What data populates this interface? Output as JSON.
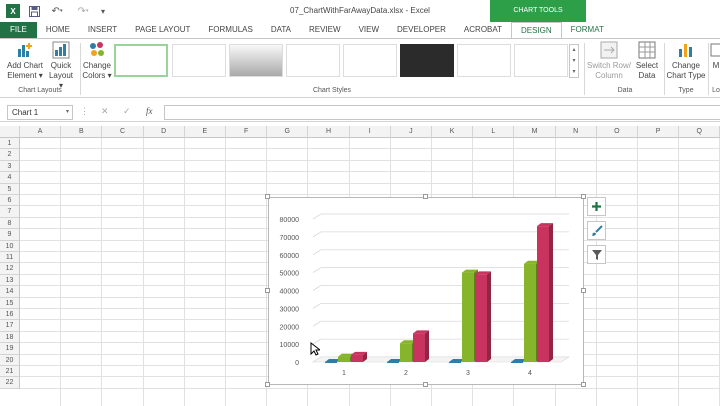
{
  "window": {
    "title": "07_ChartWithFarAwayData.xlsx - Excel",
    "context_tab": "CHART TOOLS"
  },
  "tabs": [
    "FILE",
    "HOME",
    "INSERT",
    "PAGE LAYOUT",
    "FORMULAS",
    "DATA",
    "REVIEW",
    "VIEW",
    "DEVELOPER",
    "ACROBAT",
    "DESIGN",
    "FORMAT"
  ],
  "ribbon": {
    "add_chart_element": [
      "Add Chart",
      "Element ▾"
    ],
    "quick_layout": [
      "Quick",
      "Layout ▾"
    ],
    "change_colors": [
      "Change",
      "Colors ▾"
    ],
    "switch_row_column": [
      "Switch Row/",
      "Column"
    ],
    "select_data": [
      "Select",
      "Data"
    ],
    "change_chart_type": [
      "Change",
      "Chart Type"
    ],
    "move_chart": [
      "M",
      "Lo"
    ],
    "groups": {
      "chart_layouts": "Chart Layouts",
      "chart_styles": "Chart Styles",
      "data": "Data",
      "type": "Type"
    }
  },
  "formula_bar": {
    "name_box": "Chart 1",
    "cancel": "✕",
    "enter": "✓",
    "fx": "fx",
    "value": ""
  },
  "columns": [
    "A",
    "B",
    "C",
    "D",
    "E",
    "F",
    "G",
    "H",
    "I",
    "J",
    "K",
    "L",
    "M",
    "N",
    "O",
    "P",
    "Q"
  ],
  "rows": [
    "1",
    "2",
    "3",
    "4",
    "5",
    "6",
    "7",
    "8",
    "9",
    "10",
    "11",
    "12",
    "13",
    "14",
    "15",
    "16",
    "17",
    "18",
    "19",
    "20",
    "21",
    "22"
  ],
  "colors": {
    "green": "#86b42a",
    "crimson": "#c8335f",
    "teal": "#2e7fa6",
    "excel_green": "#217346"
  },
  "chart_data": {
    "type": "bar",
    "categories": [
      "1",
      "2",
      "3",
      "4"
    ],
    "series": [
      {
        "values": [
          0,
          0,
          0,
          0
        ]
      },
      {
        "values": [
          3000,
          10500,
          50000,
          55000
        ]
      },
      {
        "values": [
          4000,
          16000,
          49000,
          76000
        ]
      }
    ],
    "y_ticks": [
      "80000",
      "70000",
      "60000",
      "50000",
      "40000",
      "30000",
      "20000",
      "10000",
      "0"
    ],
    "ylim": [
      0,
      80000
    ],
    "grid": true,
    "style": "3d-clustered-column"
  }
}
